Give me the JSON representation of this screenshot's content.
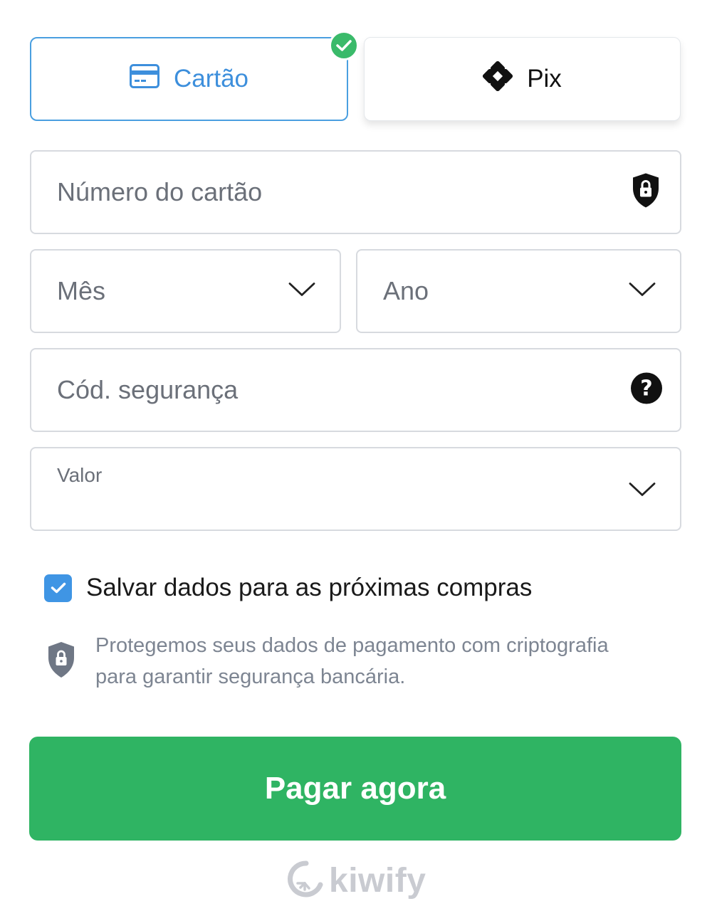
{
  "payment_methods": {
    "card": {
      "label": "Cartão",
      "icon": "credit-card-icon",
      "selected": true
    },
    "pix": {
      "label": "Pix",
      "icon": "pix-icon",
      "selected": false
    }
  },
  "form": {
    "card_number": {
      "placeholder": "Número do cartão",
      "icon": "lock-shield-icon"
    },
    "month": {
      "placeholder": "Mês",
      "icon": "chevron-down-icon"
    },
    "year": {
      "placeholder": "Ano",
      "icon": "chevron-down-icon"
    },
    "security_code": {
      "placeholder": "Cód. segurança",
      "icon": "help-circle-icon"
    },
    "amount": {
      "label": "Valor",
      "value": "",
      "icon": "chevron-down-icon"
    }
  },
  "save_data": {
    "label": "Salvar dados para as próximas compras",
    "checked": true
  },
  "security_notice": {
    "line1": "Protegemos seus dados de pagamento com criptografia",
    "line2": "para garantir segurança bancária."
  },
  "pay_button": {
    "label": "Pagar agora"
  },
  "brand": {
    "name": "kiwify"
  },
  "colors": {
    "accent_blue": "#3d8fdc",
    "success_green": "#2fb463",
    "check_green": "#3aba6a",
    "muted_text": "#7d8592"
  }
}
